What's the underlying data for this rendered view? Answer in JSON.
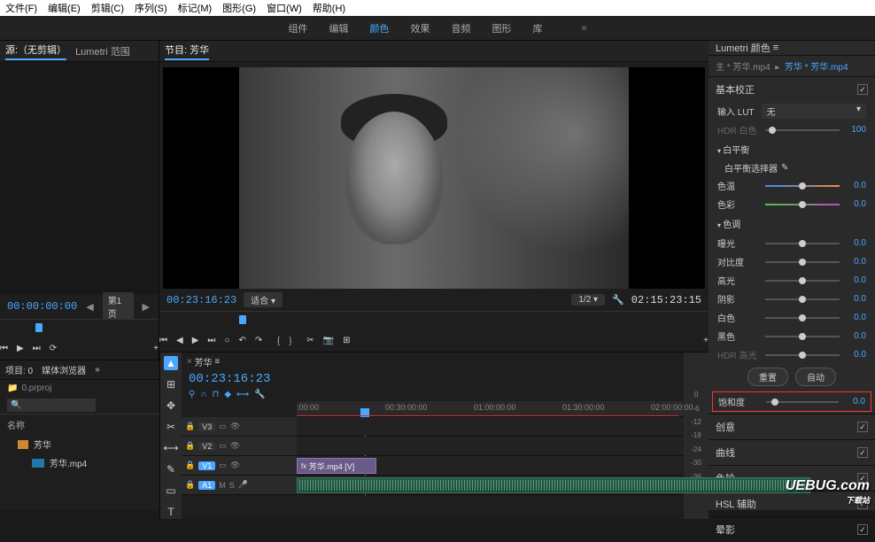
{
  "menubar": [
    "文件(F)",
    "编辑(E)",
    "剪辑(C)",
    "序列(S)",
    "标记(M)",
    "图形(G)",
    "窗口(W)",
    "帮助(H)"
  ],
  "workspace_tabs": {
    "items": [
      "组件",
      "编辑",
      "颜色",
      "效果",
      "音频",
      "图形",
      "库"
    ],
    "active_index": 2,
    "more": "»"
  },
  "source_panel": {
    "tabs": [
      "源:（无剪辑）",
      "Lumetri 范围"
    ],
    "active": 0,
    "timecode": "00:00:00:00",
    "pager": "第1页",
    "transport_icons": [
      "⏮",
      "▶",
      "⏭",
      "⟳"
    ]
  },
  "program_panel": {
    "title": "节目: 芳华",
    "timecode_left": "00:23:16:23",
    "fit_label": "适合",
    "scale_label": "1/2",
    "wrench": "🔧",
    "timecode_right": "02:15:23:15",
    "transport_icons": [
      "⏮",
      "◀",
      "▶",
      "⏭",
      "○",
      "↶",
      "↷",
      "｛",
      "｝",
      "✂",
      "📷",
      "⊞"
    ]
  },
  "project_panel": {
    "tabs": [
      "项目: 0",
      "媒体浏览器"
    ],
    "active": 0,
    "crumb": "0.prproj",
    "search_placeholder": "🔍",
    "col": "名称",
    "items": [
      {
        "type": "bin",
        "name": "芳华"
      },
      {
        "type": "clip",
        "name": "芳华.mp4"
      }
    ]
  },
  "toolbar": [
    "▲",
    "⊞",
    "✥",
    "✂",
    "⟷",
    "✎",
    "▭",
    "T"
  ],
  "timeline": {
    "title": "芳华",
    "timecode": "00:23:16:23",
    "ctrl_icons": [
      "⚲",
      "∩",
      "⊓",
      "◆",
      "⟷",
      "🔧"
    ],
    "ruler": [
      ":00:00",
      "00:30:00:00",
      "01:00:00:00",
      "01:30:00:00",
      "02:00:00:00"
    ],
    "tracks": [
      {
        "id": "V3",
        "active": false,
        "icons": [
          "🔒",
          "👁"
        ]
      },
      {
        "id": "V2",
        "active": false,
        "icons": [
          "🔒",
          "👁"
        ]
      },
      {
        "id": "V1",
        "active": true,
        "icons": [
          "🔒",
          "👁"
        ],
        "clip": "芳华.mp4 [V]"
      },
      {
        "id": "A1",
        "active": true,
        "icons": [
          "🔒",
          "M",
          "S",
          "🎤"
        ],
        "audio": true
      }
    ],
    "levels": [
      "0",
      "-6",
      "-12",
      "-18",
      "-24",
      "-30",
      "-36"
    ]
  },
  "lumetri": {
    "title": "Lumetri 颜色",
    "master": "主 * 芳华.mp4",
    "clip": "芳华 * 芳华.mp4",
    "section_basic": "基本校正",
    "lut_label": "输入 LUT",
    "lut_value": "无",
    "hdr_white": {
      "label": "HDR 白色",
      "value": "100"
    },
    "wb_section": "白平衡",
    "wb_picker": "白平衡选择器",
    "sliders_wb": [
      {
        "label": "色温",
        "value": "0.0",
        "type": "temp"
      },
      {
        "label": "色彩",
        "value": "0.0",
        "type": "tint"
      }
    ],
    "tone_section": "色调",
    "sliders_tone": [
      {
        "label": "曝光",
        "value": "0.0"
      },
      {
        "label": "对比度",
        "value": "0.0"
      },
      {
        "label": "高光",
        "value": "0.0"
      },
      {
        "label": "阴影",
        "value": "0.0"
      },
      {
        "label": "白色",
        "value": "0.0"
      },
      {
        "label": "黑色",
        "value": "0.0"
      }
    ],
    "hdr_hl": {
      "label": "HDR 高光",
      "value": "0.0"
    },
    "btn_reset": "重置",
    "btn_auto": "自动",
    "saturation": {
      "label": "饱和度",
      "value": "0.0"
    },
    "collapsed": [
      "创意",
      "曲线",
      "色轮",
      "HSL 辅助",
      "晕影"
    ]
  },
  "watermark": {
    "brand": "UEBUG.com",
    "sub": "下载站"
  }
}
